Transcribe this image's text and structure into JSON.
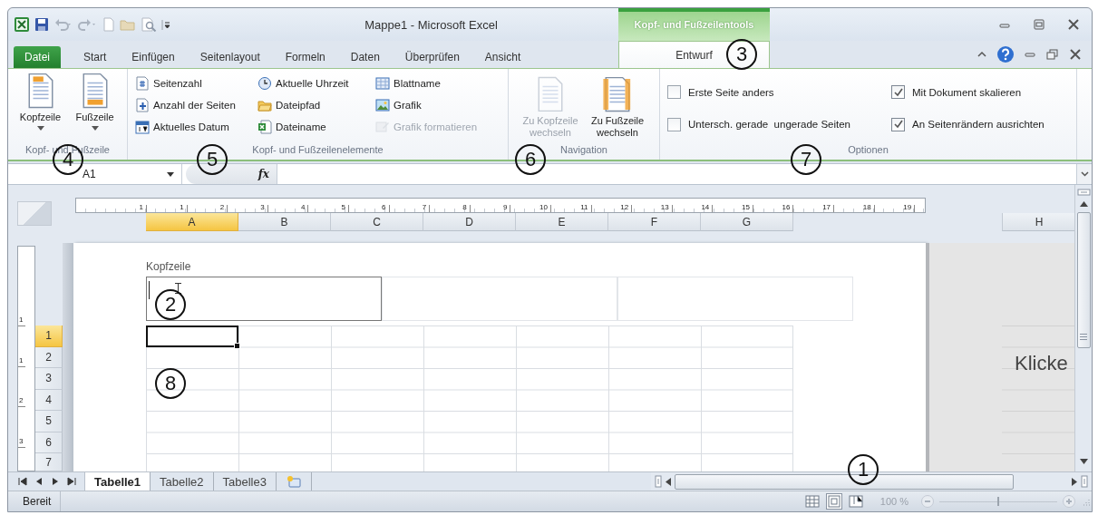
{
  "window": {
    "title": "Mappe1 - Microsoft Excel",
    "context_header": "Kopf- und Fußzeilentools"
  },
  "tabs": [
    {
      "label": "Datei",
      "kind": "file",
      "selected": false
    },
    {
      "label": "Start",
      "kind": "tab",
      "selected": false
    },
    {
      "label": "Einfügen",
      "kind": "tab",
      "selected": false
    },
    {
      "label": "Seitenlayout",
      "kind": "tab",
      "selected": false
    },
    {
      "label": "Formeln",
      "kind": "tab",
      "selected": false
    },
    {
      "label": "Daten",
      "kind": "tab",
      "selected": false
    },
    {
      "label": "Überprüfen",
      "kind": "tab",
      "selected": false
    },
    {
      "label": "Ansicht",
      "kind": "tab",
      "selected": false
    },
    {
      "label": "Entwurf",
      "kind": "context",
      "selected": true
    }
  ],
  "ribbon_groups": [
    {
      "kind": "large",
      "label": "Kopf- und Fußzeile",
      "buttons": [
        {
          "label": "Kopfzeile",
          "dropdown": true,
          "disabled": false
        },
        {
          "label": "Fußzeile",
          "dropdown": true,
          "disabled": false
        }
      ]
    },
    {
      "kind": "small",
      "label": "Kopf- und Fußzeilenelemente",
      "buttons": [
        {
          "label": "Seitenzahl",
          "disabled": false
        },
        {
          "label": "Anzahl der Seiten",
          "disabled": false
        },
        {
          "label": "Aktuelles Datum",
          "disabled": false
        },
        {
          "label": "Aktuelle Uhrzeit",
          "disabled": false
        },
        {
          "label": "Dateipfad",
          "disabled": false
        },
        {
          "label": "Dateiname",
          "disabled": false
        },
        {
          "label": "Blattname",
          "disabled": false
        },
        {
          "label": "Grafik",
          "disabled": false
        },
        {
          "label": "Grafik formatieren",
          "disabled": true
        }
      ]
    },
    {
      "kind": "large",
      "label": "Navigation",
      "buttons": [
        {
          "label": "Zu Kopfzeile wechseln",
          "dropdown": false,
          "disabled": true
        },
        {
          "label": "Zu Fußzeile wechseln",
          "dropdown": false,
          "disabled": false
        }
      ]
    },
    {
      "kind": "checks",
      "label": "Optionen",
      "options": [
        {
          "label": "Erste Seite anders",
          "checked": false
        },
        {
          "label": "Untersch. gerade  ungerade Seiten",
          "checked": false
        },
        {
          "label": "Mit Dokument skalieren",
          "checked": true
        },
        {
          "label": "An Seitenrändern ausrichten",
          "checked": true
        }
      ]
    }
  ],
  "name_box": {
    "value": "A1"
  },
  "formula_bar": {
    "function_label": "fx"
  },
  "ruler": {
    "labels": [
      "1",
      "1",
      "2",
      "3",
      "4",
      "5",
      "6",
      "7",
      "8",
      "9",
      "10",
      "11",
      "12",
      "13",
      "14",
      "15",
      "16",
      "17",
      "18",
      "19"
    ]
  },
  "columns": [
    {
      "label": "A",
      "selected": true
    },
    {
      "label": "B",
      "selected": false
    },
    {
      "label": "C",
      "selected": false
    },
    {
      "label": "D",
      "selected": false
    },
    {
      "label": "E",
      "selected": false
    },
    {
      "label": "F",
      "selected": false
    },
    {
      "label": "G",
      "selected": false
    }
  ],
  "next_page": {
    "column": "H",
    "text": "Klicke"
  },
  "vertical_ruler": {
    "labels": [
      "1",
      "1",
      "2",
      "3"
    ]
  },
  "header": {
    "label": "Kopfzeile",
    "sections": [
      {
        "selected": true
      },
      {
        "selected": false
      },
      {
        "selected": false
      }
    ]
  },
  "rows": [
    {
      "label": "1",
      "selected": true
    },
    {
      "label": "2",
      "selected": false
    },
    {
      "label": "3",
      "selected": false
    },
    {
      "label": "4",
      "selected": false
    },
    {
      "label": "5",
      "selected": false
    },
    {
      "label": "6",
      "selected": false
    },
    {
      "label": "7",
      "selected": false
    }
  ],
  "sheet_tabs": [
    {
      "label": "Tabelle1",
      "selected": true
    },
    {
      "label": "Tabelle2",
      "selected": false
    },
    {
      "label": "Tabelle3",
      "selected": false
    }
  ],
  "status_bar": {
    "text": "Bereit",
    "views": [
      {
        "selected": false
      },
      {
        "selected": true
      },
      {
        "selected": false
      }
    ],
    "zoom": "100 %",
    "zoom_slider": {
      "level": 0.5
    }
  },
  "callouts": [
    "3",
    "4",
    "5",
    "6",
    "7",
    "2",
    "8",
    "1"
  ]
}
